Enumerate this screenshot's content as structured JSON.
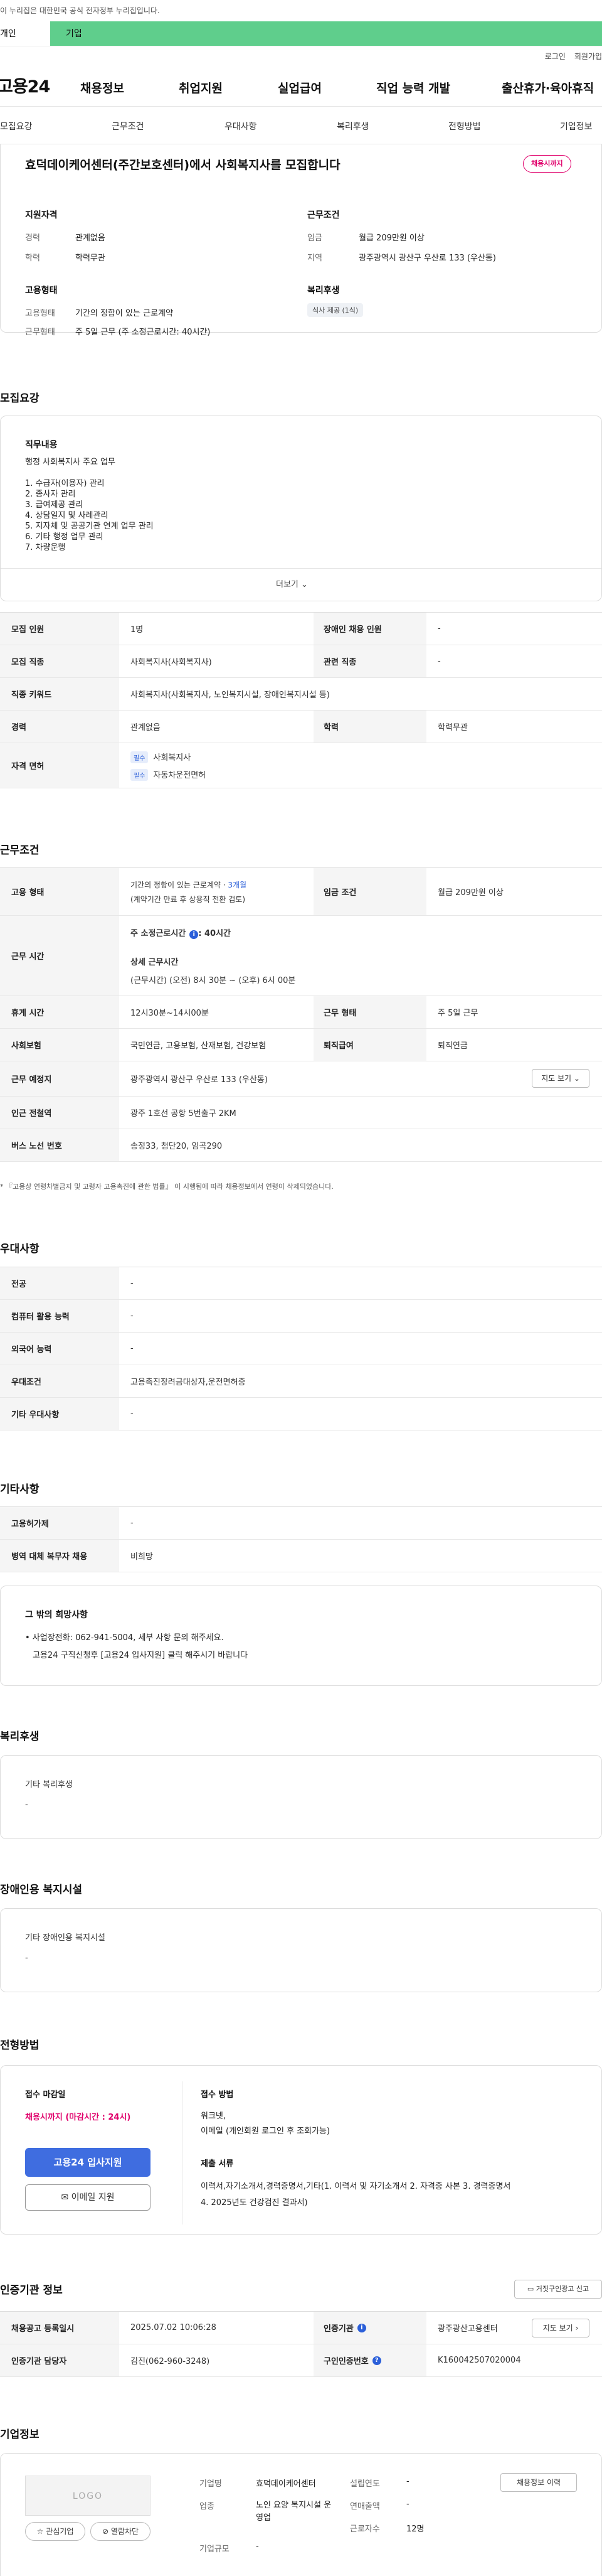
{
  "gov_banner": "이 누리집은 대한민국 공식 전자정부 누리집입니다.",
  "user_type": {
    "individual": "개인",
    "business": "기업"
  },
  "util_links": {
    "login": "로그인",
    "signup": "회원가입"
  },
  "gnb": {
    "logo": "고용24",
    "items": [
      "채용정보",
      "취업지원",
      "실업급여",
      "직업 능력 개발",
      "출산휴가·육아휴직"
    ]
  },
  "subnav": [
    "모집요강",
    "근무조건",
    "우대사항",
    "복리후생",
    "전형방법",
    "기업정보"
  ],
  "job": {
    "title": "효덕데이케어센터(주간보호센터)에서 사회복지사를 모집합니다",
    "deadline_pill": "채용시까지",
    "qual_title": "지원자격",
    "qual": [
      {
        "k": "경력",
        "v": "관계없음"
      },
      {
        "k": "학력",
        "v": "학력무관"
      }
    ],
    "cond_title": "근무조건",
    "cond": [
      {
        "k": "임금",
        "v": "월급 209만원 이상"
      },
      {
        "k": "지역",
        "v": "광주광역시 광산구 우산로 133 (우산동)"
      }
    ],
    "emp_title": "고용형태",
    "emp": [
      {
        "k": "고용형태",
        "v": "기간의 정함이 있는 근로계약"
      },
      {
        "k": "근무형태",
        "v": "주 5일 근무 (주 소정근로시간: 40시간)"
      }
    ],
    "welfare_title": "복리후생",
    "welfare_chip": "식사 제공 (1식)"
  },
  "recruit": {
    "section": "모집요강",
    "duty_title": "직무내용",
    "duty_lines": [
      "행정 사회복지사 주요 업무",
      "",
      "1. 수급자(이용자) 관리",
      "2. 종사자 관리",
      "3. 급여제공 관리",
      "4. 상담일지 및 사례관리",
      "5. 지자체 및 공공기관 연계 업무 관리",
      "6. 기타 행정 업무 관리",
      "7. 차량운행"
    ],
    "more": "더보기",
    "rows": [
      {
        "k1": "모집 인원",
        "v1": "1명",
        "k2": "장애인 채용 인원",
        "v2": "-"
      },
      {
        "k1": "모집 직종",
        "v1": "사회복지사(사회복지사)",
        "k2": "관련 직종",
        "v2": "-"
      }
    ],
    "keyword_label": "직종 키워드",
    "keyword_value": "사회복지사(사회복지사, 노인복지시설, 장애인복지시설 등)",
    "edu_row": {
      "k1": "경력",
      "v1": "관계없음",
      "k2": "학력",
      "v2": "학력무관"
    },
    "license_label": "자격 면허",
    "license_badge": "필수",
    "licenses": [
      "사회복지사",
      "자동차운전면허"
    ]
  },
  "work": {
    "section": "근무조건",
    "type_label": "고용 형태",
    "type_value_1": "기간의 정함이 있는 근로계약 · ",
    "type_value_month": "3개월",
    "type_value_2": "(계약기간 만료 후 상용직 전환 검토)",
    "wage_label": "임금 조건",
    "wage_value": "월급 209만원 이상",
    "time_label": "근무 시간",
    "time_main": "주 소정근로시간",
    "time_main_value": ": 40시간",
    "time_detail_title": "상세 근무시간",
    "time_detail": "(근무시간) (오전) 8시 30분 ~ (오후) 6시 00분",
    "rest_label": "휴게 시간",
    "rest_value": "12시30분~14시00분",
    "form_label": "근무 형태",
    "form_value": "주 5일 근무",
    "ins_label": "사회보험",
    "ins_value": "국민연금, 고용보험, 산재보험, 건강보험",
    "retire_label": "퇴직급여",
    "retire_value": "퇴직연금",
    "place_label": "근무 예정지",
    "place_value": "광주광역시 광산구 우산로 133 (우산동)",
    "map_btn": "지도 보기",
    "subway_label": "인근 전철역",
    "subway_value": "광주 1호선 공항 5번출구 2KM",
    "bus_label": "버스 노선 번호",
    "bus_value": "송정33, 첨단20, 임곡290",
    "footnote": "* 『고용상 연령차별금지 및 고령자 고용촉진에 관한 법률』 이 시행됨에 따라 채용정보에서 연령이 삭제되었습니다."
  },
  "pref": {
    "section": "우대사항",
    "rows": [
      {
        "k": "전공",
        "v": "-"
      },
      {
        "k": "컴퓨터 활용 능력",
        "v": "-"
      },
      {
        "k": "외국어 능력",
        "v": "-"
      },
      {
        "k": "우대조건",
        "v": "고용촉진장려금대상자,운전면허증"
      },
      {
        "k": "기타 우대사항",
        "v": "-"
      }
    ]
  },
  "etc": {
    "section": "기타사항",
    "rows": [
      {
        "k": "고용허가제",
        "v": "-"
      },
      {
        "k": "병역 대체 복무자 채용",
        "v": "비희망"
      }
    ],
    "other_title": "그 밖의 희망사항",
    "other_lines": [
      "• 사업장전화: 062-941-5004, 세부 사항 문의 해주세요.",
      "고용24 구직신청후 [고용24 입사지원] 클릭 해주시기 바랍니다"
    ]
  },
  "welfare": {
    "section": "복리후생",
    "title": "기타 복리후생",
    "value": "-"
  },
  "disability": {
    "section": "장애인용 복지시설",
    "title": "기타 장애인용 복지시설",
    "value": "-"
  },
  "process": {
    "section": "전형방법",
    "deadline_title": "접수 마감일",
    "deadline_value": "채용시까지 (마감시간 : 24시)",
    "apply_btn": "고용24 입사지원",
    "email_btn": "이메일 지원",
    "method_title": "접수 방법",
    "method_lines": [
      "워크넷,",
      "이메일 (개인회원 로그인 후 조회가능)"
    ],
    "docs_title": "제출 서류",
    "docs_lines": [
      "이력서,자기소개서,경력증명서,기타(1. 이력서 및 자기소개서 2. 자격증 사본 3. 경력증명서",
      "4. 2025년도 건강검진 결과서)"
    ]
  },
  "cert": {
    "section": "인증기관 정보",
    "report_btn": "거짓구인광고 신고",
    "rows": [
      {
        "k1": "채용공고 등록일시",
        "v1": "2025.07.02 10:06:28",
        "k2": "인증기관",
        "v2": "광주광산고용센터",
        "btn": "지도 보기"
      },
      {
        "k1": "인증기관 담당자",
        "v1": "김진(062-960-3248)",
        "k2": "구인인증번호",
        "v2": "K160042507020004",
        "btn": ""
      }
    ]
  },
  "company": {
    "section": "기업정보",
    "logo_text": "LOGO",
    "fav_btn": "관심기업",
    "block_btn": "열람차단",
    "fields": [
      {
        "k": "기업명",
        "v": "효덕데이케어센터"
      },
      {
        "k": "업종",
        "v": "노인 요양 복지시설 운영업"
      },
      {
        "k": "기업규모",
        "v": "-"
      }
    ],
    "fields2": [
      {
        "k": "설립연도",
        "v": "-"
      },
      {
        "k": "연매출액",
        "v": "-"
      },
      {
        "k": "근로자수",
        "v": "12명"
      }
    ],
    "history_btn": "채용정보 이력"
  },
  "colors": {
    "accent": "#3f6de0",
    "deadline": "#e0006b",
    "business_bar": "#5fce8c"
  }
}
